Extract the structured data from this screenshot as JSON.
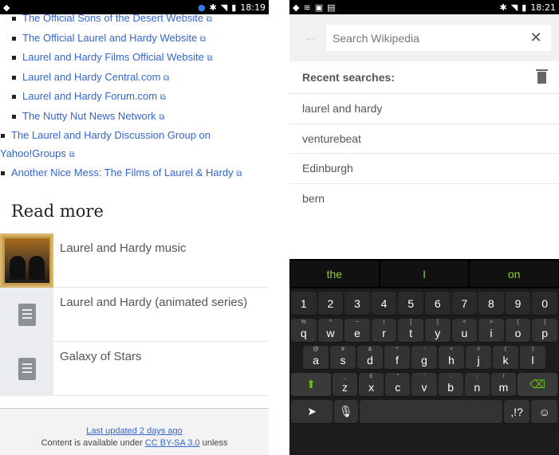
{
  "left": {
    "status_time": "18:19",
    "links": [
      "The Official Sons of the Desert Website",
      "The Official Laurel and Hardy Website",
      "Laurel and Hardy Films Official Website",
      "Laurel and Hardy Central.com",
      "Laurel and Hardy Forum.com",
      "The Nutty Nut News Network",
      "The Laurel and Hardy Discussion Group on Yahoo!Groups",
      "Another Nice Mess: The Films of Laurel & Hardy"
    ],
    "read_more_heading": "Read more",
    "read_more_items": [
      "Laurel and Hardy music",
      "Laurel and Hardy (animated series)",
      "Galaxy of Stars"
    ],
    "footer": {
      "last_updated": "Last updated 2 days ago",
      "content_prefix": "Content is available under",
      "license": "CC BY-SA 3.0",
      "content_suffix": "unless"
    }
  },
  "right": {
    "status_time": "18:21",
    "search_placeholder": "Search Wikipedia",
    "recent_heading": "Recent searches:",
    "recent_items": [
      "laurel and hardy",
      "venturebeat",
      "Edinburgh",
      "bern"
    ],
    "keyboard": {
      "suggestions": [
        "the",
        "I",
        "on"
      ],
      "number_row": [
        "1",
        "2",
        "3",
        "4",
        "5",
        "6",
        "7",
        "8",
        "9",
        "0"
      ],
      "row1": [
        {
          "key": "q",
          "alt": "%"
        },
        {
          "key": "w",
          "alt": "^"
        },
        {
          "key": "e",
          "alt": "~"
        },
        {
          "key": "r",
          "alt": "|"
        },
        {
          "key": "t",
          "alt": "["
        },
        {
          "key": "y",
          "alt": "]"
        },
        {
          "key": "u",
          "alt": "<"
        },
        {
          "key": "i",
          "alt": ">"
        },
        {
          "key": "o",
          "alt": "{"
        },
        {
          "key": "p",
          "alt": "}"
        }
      ],
      "row2": [
        {
          "key": "a",
          "alt": "@"
        },
        {
          "key": "s",
          "alt": "#"
        },
        {
          "key": "d",
          "alt": "&"
        },
        {
          "key": "f",
          "alt": "*"
        },
        {
          "key": "g",
          "alt": "-"
        },
        {
          "key": "h",
          "alt": "+"
        },
        {
          "key": "j",
          "alt": "="
        },
        {
          "key": "k",
          "alt": "("
        },
        {
          "key": "l",
          "alt": ")"
        }
      ],
      "row3": [
        {
          "key": "z",
          "alt": "_"
        },
        {
          "key": "x",
          "alt": "£"
        },
        {
          "key": "c",
          "alt": "\""
        },
        {
          "key": "v",
          "alt": "'"
        },
        {
          "key": "b",
          "alt": ":"
        },
        {
          "key": "n",
          "alt": ";"
        },
        {
          "key": "m",
          "alt": "/"
        }
      ],
      "punct_key": ",!?"
    }
  }
}
